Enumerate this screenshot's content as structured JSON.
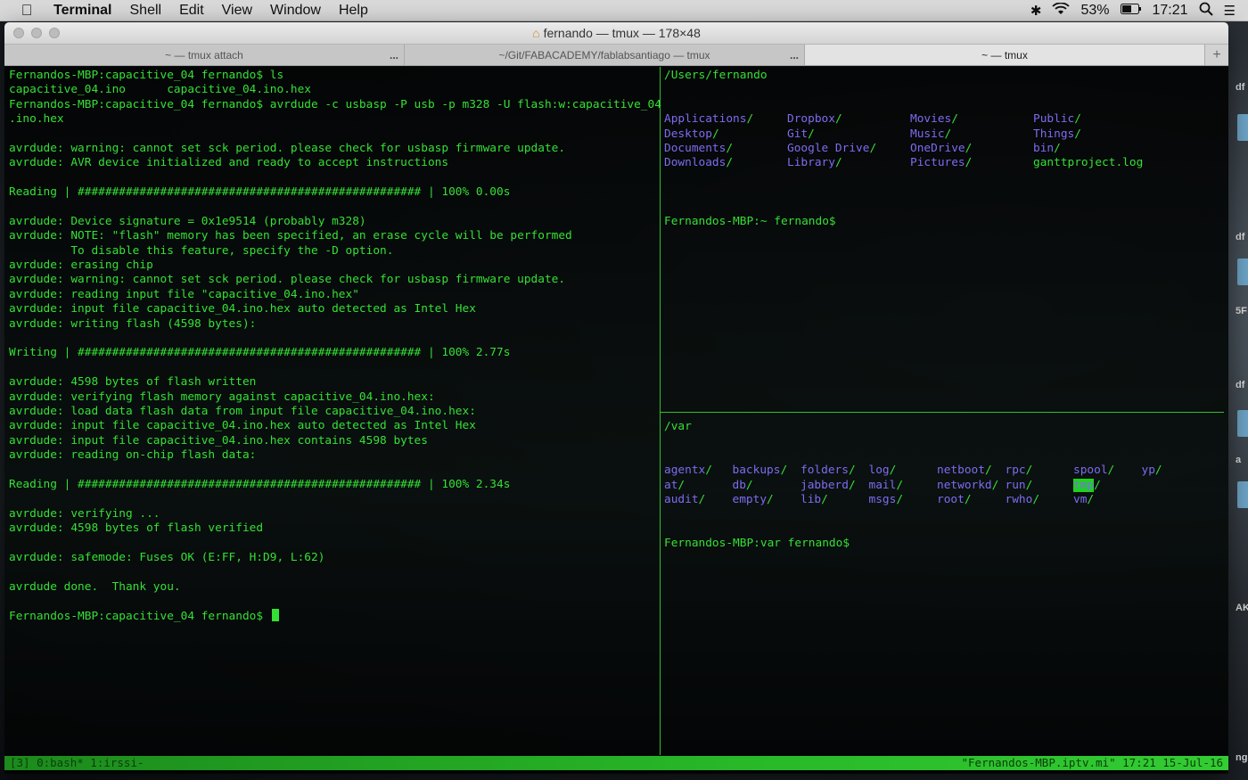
{
  "menubar": {
    "app": "Terminal",
    "items": [
      "Shell",
      "Edit",
      "View",
      "Window",
      "Help"
    ],
    "battery": "53%",
    "clock": "17:21"
  },
  "window": {
    "title": "fernando — tmux — 178×48",
    "tabs": [
      {
        "label": "~ — tmux attach",
        "active": false
      },
      {
        "label": "~/Git/FABACADEMY/fablabsantiago — tmux",
        "active": false
      },
      {
        "label": "~ — tmux",
        "active": true
      }
    ],
    "tab_more": "...",
    "tab_add": "+"
  },
  "left_pane": {
    "lines": [
      "Fernandos-MBP:capacitive_04 fernando$ ls",
      "capacitive_04.ino      capacitive_04.ino.hex",
      "Fernandos-MBP:capacitive_04 fernando$ avrdude -c usbasp -P usb -p m328 -U flash:w:capacitive_04",
      ".ino.hex",
      "",
      "avrdude: warning: cannot set sck period. please check for usbasp firmware update.",
      "avrdude: AVR device initialized and ready to accept instructions",
      "",
      "Reading | ################################################## | 100% 0.00s",
      "",
      "avrdude: Device signature = 0x1e9514 (probably m328)",
      "avrdude: NOTE: \"flash\" memory has been specified, an erase cycle will be performed",
      "         To disable this feature, specify the -D option.",
      "avrdude: erasing chip",
      "avrdude: warning: cannot set sck period. please check for usbasp firmware update.",
      "avrdude: reading input file \"capacitive_04.ino.hex\"",
      "avrdude: input file capacitive_04.ino.hex auto detected as Intel Hex",
      "avrdude: writing flash (4598 bytes):",
      "",
      "Writing | ################################################## | 100% 2.77s",
      "",
      "avrdude: 4598 bytes of flash written",
      "avrdude: verifying flash memory against capacitive_04.ino.hex:",
      "avrdude: load data flash data from input file capacitive_04.ino.hex:",
      "avrdude: input file capacitive_04.ino.hex auto detected as Intel Hex",
      "avrdude: input file capacitive_04.ino.hex contains 4598 bytes",
      "avrdude: reading on-chip flash data:",
      "",
      "Reading | ################################################## | 100% 2.34s",
      "",
      "avrdude: verifying ...",
      "avrdude: 4598 bytes of flash verified",
      "",
      "avrdude: safemode: Fuses OK (E:FF, H:D9, L:62)",
      "",
      "avrdude done.  Thank you.",
      ""
    ],
    "prompt": "Fernandos-MBP:capacitive_04 fernando$ "
  },
  "right_top_pane": {
    "cwd": "/Users/fernando",
    "listing": [
      [
        "Applications",
        "Dropbox",
        "Movies",
        "Public"
      ],
      [
        "Desktop",
        "Git",
        "Music",
        "Things"
      ],
      [
        "Documents",
        "Google Drive",
        "OneDrive",
        "bin"
      ],
      [
        "Downloads",
        "Library",
        "Pictures",
        "ganttproject.log"
      ]
    ],
    "prompt": "Fernandos-MBP:~ fernando$"
  },
  "right_bottom_pane": {
    "cwd": "/var",
    "listing": [
      [
        "agentx",
        "backups",
        "folders",
        "log",
        "netboot",
        "rpc",
        "spool",
        "yp"
      ],
      [
        "at",
        "db",
        "jabberd",
        "mail",
        "networkd",
        "run",
        "tmp"
      ],
      [
        "audit",
        "empty",
        "lib",
        "msgs",
        "root",
        "rwho",
        "vm"
      ]
    ],
    "prompt": "Fernandos-MBP:var fernando$"
  },
  "statusbar": {
    "left": "[3] 0:bash* 1:irssi-",
    "right": "\"Fernandos-MBP.iptv.mi\" 17:21 15-Jul-16"
  },
  "desktop": {
    "labels": [
      "df",
      "df",
      "5F",
      "df",
      "a",
      "AK",
      "ng"
    ]
  }
}
